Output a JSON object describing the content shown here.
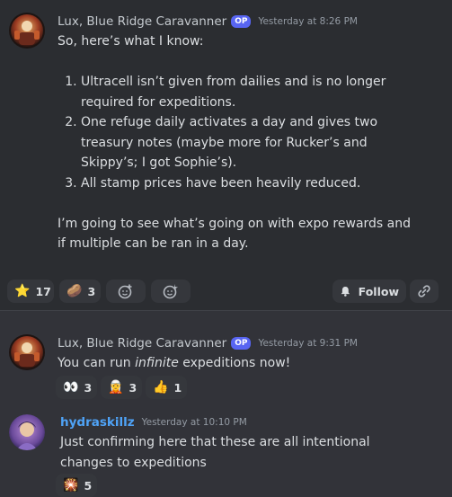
{
  "post": {
    "author": "Lux, Blue Ridge Caravanner",
    "badge": "OP",
    "timestamp": "Yesterday at 8:26 PM",
    "intro": "So, here’s what I know:",
    "items": [
      "Ultracell isn’t given from dailies and is no longer required for expeditions.",
      "One refuge daily activates a day and gives two treasury notes (maybe more for Rucker’s and Skippy’s; I got Sophie’s).",
      "All stamp prices have been heavily reduced."
    ],
    "outro": "I’m going to see what’s going on with expo rewards and if multiple can be ran in a day.",
    "reactions": [
      {
        "icon": "star-emoji",
        "glyph": "⭐",
        "count": "17"
      },
      {
        "icon": "custom-emoji",
        "glyph": "🥔",
        "count": "3"
      }
    ],
    "follow_label": "Follow"
  },
  "reply1": {
    "author": "Lux, Blue Ridge Caravanner",
    "badge": "OP",
    "timestamp": "Yesterday at 9:31 PM",
    "text_before": "You can run ",
    "text_em": "infinite",
    "text_after": " expeditions now!",
    "reactions": [
      {
        "icon": "eyes-emoji",
        "glyph": "👀",
        "count": "3"
      },
      {
        "icon": "custom-emoji",
        "glyph": "🧝",
        "count": "3"
      },
      {
        "icon": "thumbs-up-emoji",
        "glyph": "👍",
        "count": "1"
      }
    ]
  },
  "reply2": {
    "author": "hydraskillz",
    "timestamp": "Yesterday at 10:10 PM",
    "text": "Just confirming here that these are all intentional changes to expeditions",
    "reactions": [
      {
        "icon": "custom-emoji",
        "glyph": "🎇",
        "count": "5"
      }
    ]
  },
  "colors": {
    "accent": "#5865f2",
    "link_name": "#4fa3f7",
    "bg": "#323339"
  }
}
